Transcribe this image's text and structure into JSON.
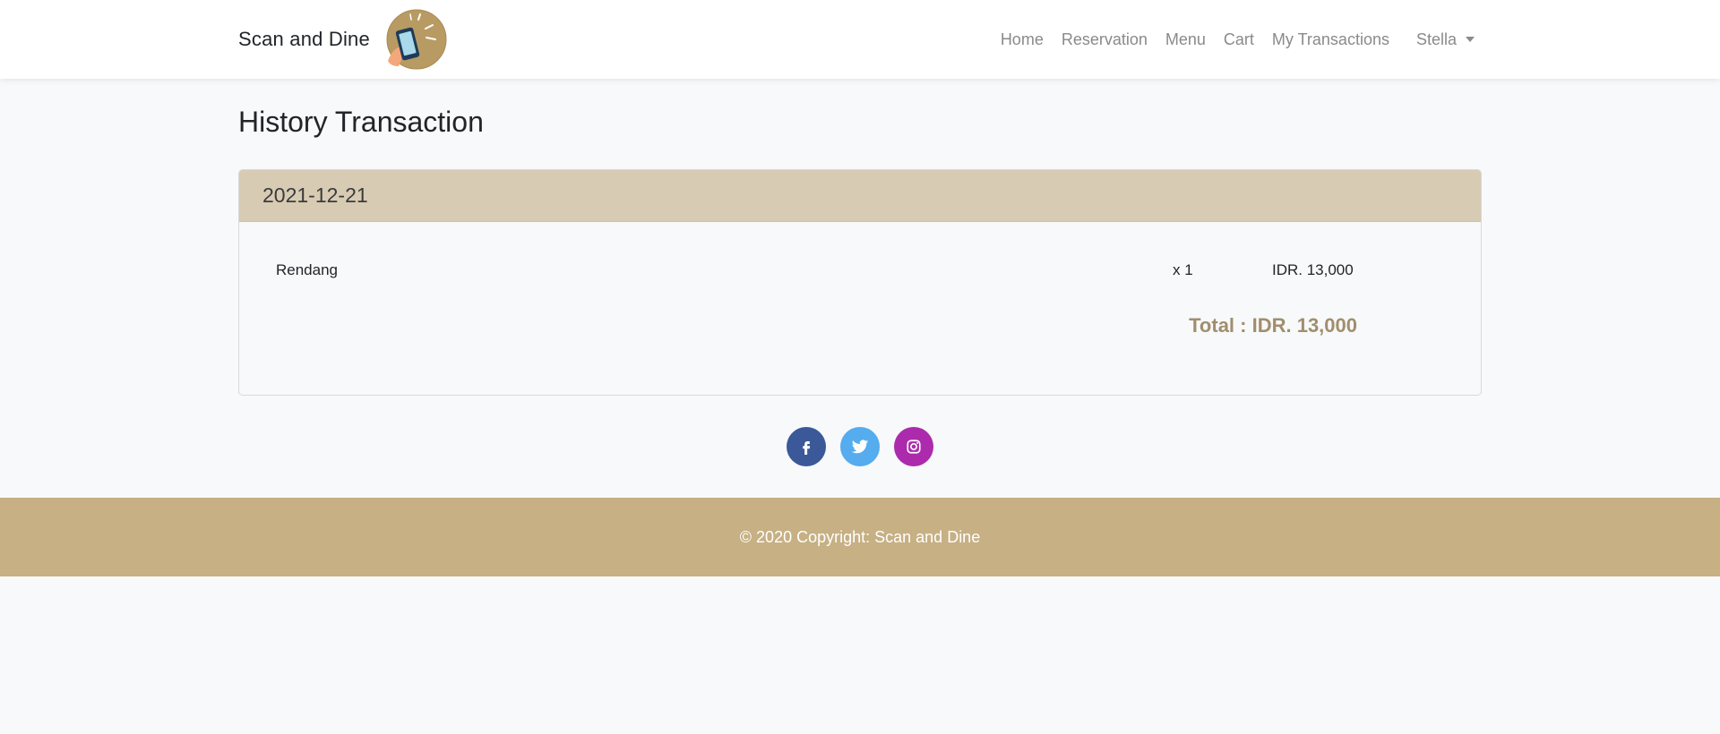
{
  "navbar": {
    "brand": "Scan and Dine",
    "links": [
      "Home",
      "Reservation",
      "Menu",
      "Cart",
      "My Transactions"
    ],
    "user": "Stella"
  },
  "main": {
    "title": "History Transaction",
    "transactions": [
      {
        "date": "2021-12-21",
        "items": [
          {
            "name": "Rendang",
            "qty": "x 1",
            "price": "IDR. 13,000"
          }
        ],
        "total": "Total : IDR. 13,000"
      }
    ]
  },
  "social": [
    {
      "name": "facebook",
      "color": "#3b5998",
      "icon": "facebook-icon"
    },
    {
      "name": "twitter",
      "color": "#55acee",
      "icon": "twitter-icon"
    },
    {
      "name": "instagram",
      "color": "#ac2bac",
      "icon": "instagram-icon"
    }
  ],
  "footer": {
    "copyright": "© 2020 Copyright: Scan and Dine"
  },
  "colors": {
    "card_header": "#d8cbb4",
    "total_text": "#a18e6d",
    "footer_bg": "#c6b084"
  }
}
